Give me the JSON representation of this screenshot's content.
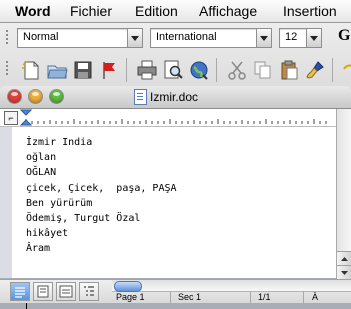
{
  "menubar": {
    "items": [
      "Word",
      "Fichier",
      "Edition",
      "Affichage",
      "Insertion"
    ]
  },
  "toolbar": {
    "style_value": "Normal",
    "font_value": "International",
    "size_value": "12",
    "bold_label": "G",
    "buttons": [
      "new-document",
      "open",
      "save",
      "flag",
      "print",
      "print-preview",
      "web-preview",
      "cut",
      "copy",
      "paste",
      "format-painter"
    ]
  },
  "window": {
    "title": "Izmir.doc"
  },
  "document": {
    "lines": [
      "İzmir India",
      "oğlan",
      "OĞLAN",
      "çicek, Çicek,  paşa, PAŞA",
      "Ben yürürüm",
      "Ödemiş, Turgut Özal",
      "hikâyet",
      "Âram"
    ]
  },
  "status": {
    "page": "Page 1",
    "section": "Sec 1",
    "pages": "1/1",
    "position": "À"
  },
  "colors": {
    "close": "#e0443e",
    "minimize": "#f0b13a",
    "zoom": "#5fbe3f",
    "accent": "#5a95e0"
  }
}
